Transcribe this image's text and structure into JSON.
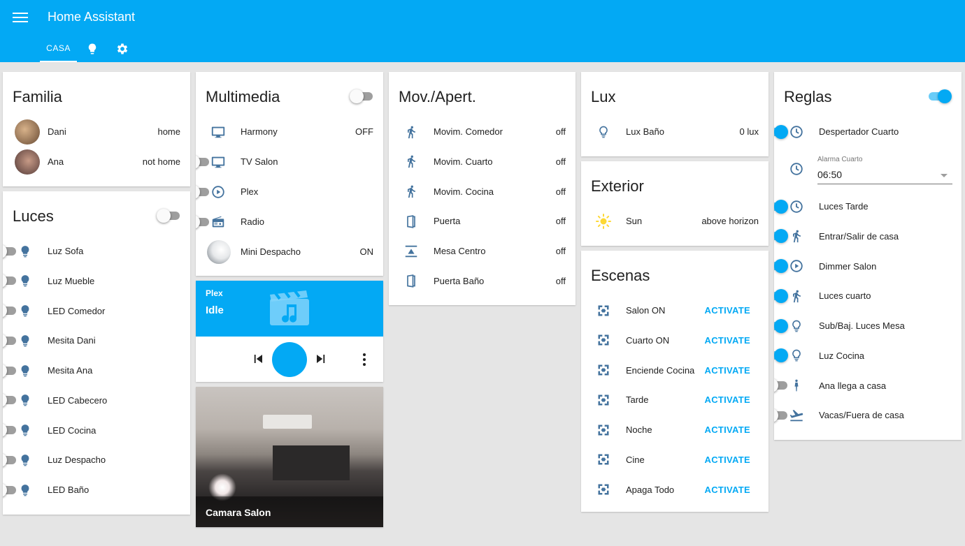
{
  "app": {
    "title": "Home Assistant"
  },
  "tabs": [
    {
      "label": "CASA"
    }
  ],
  "colors": {
    "primary": "#03a9f4",
    "icon": "#44739e",
    "sun": "#fdd835",
    "background": "#e5e5e5"
  },
  "familia": {
    "title": "Familia",
    "people": [
      {
        "name": "Dani",
        "state": "home"
      },
      {
        "name": "Ana",
        "state": "not home"
      }
    ]
  },
  "luces": {
    "title": "Luces",
    "master_on": false,
    "items": [
      {
        "name": "Luz Sofa",
        "on": false
      },
      {
        "name": "Luz Mueble",
        "on": false
      },
      {
        "name": "LED Comedor",
        "on": false
      },
      {
        "name": "Mesita Dani",
        "on": false
      },
      {
        "name": "Mesita Ana",
        "on": false
      },
      {
        "name": "LED Cabecero",
        "on": false
      },
      {
        "name": "LED Cocina",
        "on": false
      },
      {
        "name": "Luz Despacho",
        "on": false
      },
      {
        "name": "LED Baño",
        "on": false
      }
    ]
  },
  "multimedia": {
    "title": "Multimedia",
    "master_on": false,
    "items": [
      {
        "name": "Harmony",
        "icon": "tv-icon",
        "state": "OFF"
      },
      {
        "name": "TV Salon",
        "icon": "tv-icon",
        "toggle": false
      },
      {
        "name": "Plex",
        "icon": "play-circle-icon",
        "toggle": false
      },
      {
        "name": "Radio",
        "icon": "radio-icon",
        "toggle": false
      },
      {
        "name": "Mini Despacho",
        "icon": "speaker-image",
        "state": "ON"
      }
    ]
  },
  "media_player": {
    "source": "Plex",
    "state": "Idle"
  },
  "camera": {
    "name": "Camara Salon"
  },
  "movimiento": {
    "title": "Mov./Apert.",
    "items": [
      {
        "name": "Movim. Comedor",
        "icon": "walk-icon",
        "state": "off"
      },
      {
        "name": "Movim. Cuarto",
        "icon": "walk-icon",
        "state": "off"
      },
      {
        "name": "Movim. Cocina",
        "icon": "walk-icon",
        "state": "off"
      },
      {
        "name": "Puerta",
        "icon": "door-icon",
        "state": "off"
      },
      {
        "name": "Mesa Centro",
        "icon": "table-sensor-icon",
        "state": "off"
      },
      {
        "name": "Puerta Baño",
        "icon": "door-icon",
        "state": "off"
      }
    ]
  },
  "lux": {
    "title": "Lux",
    "items": [
      {
        "name": "Lux Baño",
        "state": "0 lux"
      }
    ]
  },
  "exterior": {
    "title": "Exterior",
    "items": [
      {
        "name": "Sun",
        "state": "above horizon"
      }
    ]
  },
  "escenas": {
    "title": "Escenas",
    "action_label": "ACTIVATE",
    "items": [
      {
        "name": "Salon ON"
      },
      {
        "name": "Cuarto ON"
      },
      {
        "name": "Enciende Cocina"
      },
      {
        "name": "Tarde"
      },
      {
        "name": "Noche"
      },
      {
        "name": "Cine"
      },
      {
        "name": "Apaga Todo"
      }
    ]
  },
  "reglas": {
    "title": "Reglas",
    "master_on": true,
    "alarm": {
      "label": "Alarma Cuarto",
      "value": "06:50"
    },
    "items": [
      {
        "name": "Despertador Cuarto",
        "icon": "clock-icon",
        "on": true
      },
      {
        "name": "Luces Tarde",
        "icon": "clock-icon",
        "on": true
      },
      {
        "name": "Entrar/Salir de casa",
        "icon": "walk-icon",
        "on": true
      },
      {
        "name": "Dimmer Salon",
        "icon": "play-circle-icon",
        "on": true
      },
      {
        "name": "Luces cuarto",
        "icon": "walk-icon",
        "on": true
      },
      {
        "name": "Sub/Baj. Luces Mesa",
        "icon": "bulb-outline-icon",
        "on": true
      },
      {
        "name": "Luz Cocina",
        "icon": "bulb-outline-icon",
        "on": true
      },
      {
        "name": "Ana llega a casa",
        "icon": "person-icon",
        "on": false
      },
      {
        "name": "Vacas/Fuera de casa",
        "icon": "airplane-icon",
        "on": false
      }
    ]
  }
}
